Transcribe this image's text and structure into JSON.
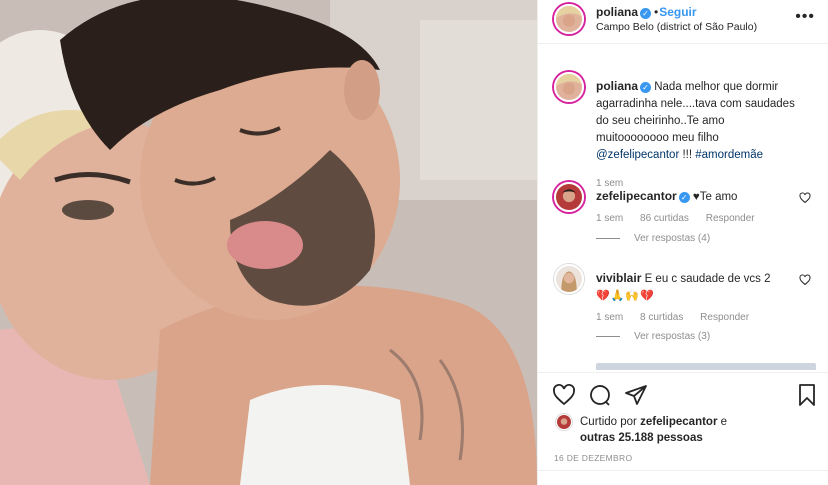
{
  "post": {
    "username": "poliana",
    "follow_label": "Seguir",
    "location": "Campo Belo (district of São Paulo)",
    "more_icon": "ellipsis-icon"
  },
  "caption": {
    "username": "poliana",
    "text": "Nada melhor que dormir agarradinha nele....tava com saudades do seu cheirinho..Te amo muitoooooooo meu filho",
    "mention": "@zefelipecantor",
    "suffix": " !!! ",
    "hashtag": "#amordemãe",
    "time": "1 sem"
  },
  "comments": [
    {
      "username": "zefelipecantor",
      "text": "♥Te amo",
      "time": "1 sem",
      "likes": "86 curtidas",
      "reply_label": "Responder",
      "view_replies": "Ver respostas (4)"
    },
    {
      "username": "viviblair",
      "text": "E eu c saudade de vcs 2",
      "emojis": "💔🙏🙌💔",
      "time": "1 sem",
      "likes": "8 curtidas",
      "reply_label": "Responder",
      "view_replies": "Ver respostas (3)"
    }
  ],
  "likes": {
    "prefix": "Curtido por ",
    "user": "zefelipecantor",
    "middle": " e",
    "count": "outras 25.188 pessoas"
  },
  "date": "16 DE DEZEMBRO",
  "icons": [
    "heart-icon",
    "comment-icon",
    "share-icon",
    "bookmark-icon",
    "verified-badge-icon"
  ],
  "colors": {
    "link": "#003569",
    "follow": "#3897f0",
    "muted": "#8e8e8e",
    "text": "#262626"
  }
}
